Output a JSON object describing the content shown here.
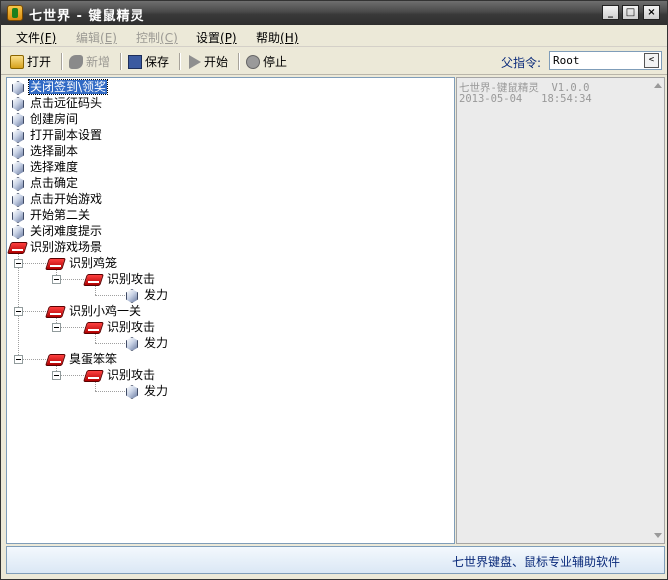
{
  "window": {
    "title": "七世界 - 键鼠精灵",
    "buttons": {
      "minimize": "_",
      "maximize": "□",
      "close": "×"
    }
  },
  "menu": [
    {
      "label": "文件",
      "accel": "(F)",
      "enabled": true
    },
    {
      "label": "编辑",
      "accel": "(E)",
      "enabled": false
    },
    {
      "label": "控制",
      "accel": "(C)",
      "enabled": false
    },
    {
      "label": "设置",
      "accel": "(P)",
      "enabled": true
    },
    {
      "label": "帮助",
      "accel": "(H)",
      "enabled": true
    }
  ],
  "toolbar": {
    "open": "打开",
    "new": "新增",
    "save": "保存",
    "start": "开始",
    "stop": "停止",
    "stop_icon_text": "STOP",
    "command_label": "父指令:",
    "command_value": "Root",
    "command_button": "<"
  },
  "tree": {
    "selected": "关闭签到\\领奖",
    "actions": [
      "关闭签到\\领奖",
      "点击远征码头",
      "创建房间",
      "打开副本设置",
      "选择副本",
      "选择难度",
      "点击确定",
      "点击开始游戏",
      "开始第二关",
      "关闭难度提示"
    ],
    "group_label": "识别游戏场景",
    "scenes": [
      {
        "label": "识别鸡笼",
        "sub": "识别攻击",
        "action": "发力"
      },
      {
        "label": "识别小鸡一关",
        "sub": "识别攻击",
        "action": "发力"
      },
      {
        "label": "臭蛋笨笨",
        "sub": "识别攻击",
        "action": "发力"
      }
    ]
  },
  "info": {
    "line1": "七世界-键鼠精灵  V1.0.0",
    "line2": "2013-05-04   18:54:34"
  },
  "status": {
    "text": "七世界键盘、鼠标专业辅助软件"
  },
  "icons": {
    "app": "app-icon",
    "action_node": "gem-icon",
    "group_node": "red-book-icon"
  }
}
